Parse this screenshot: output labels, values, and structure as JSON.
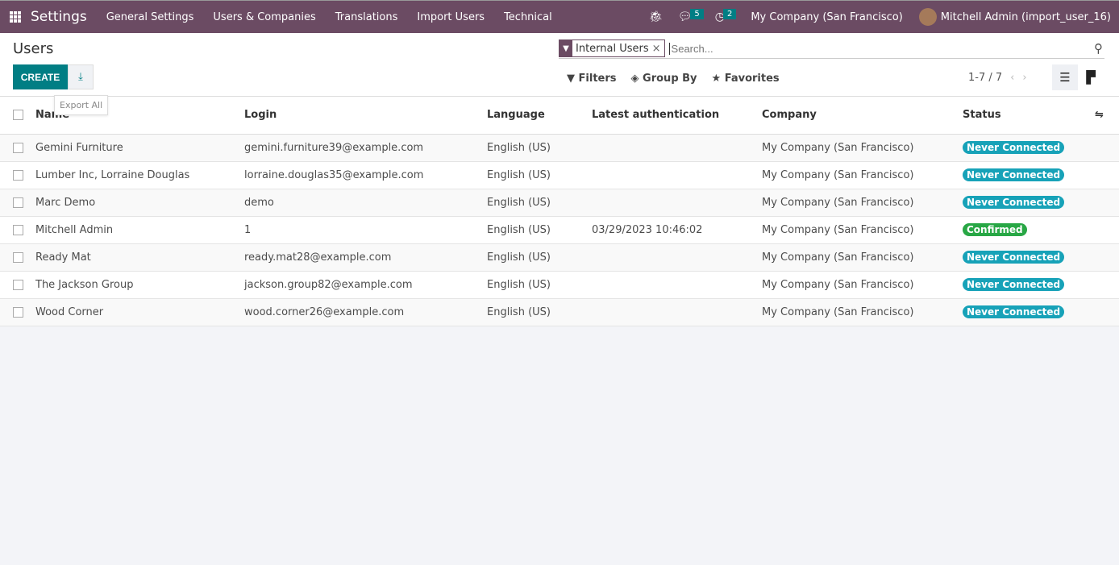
{
  "nav": {
    "brand": "Settings",
    "menus": [
      "General Settings",
      "Users & Companies",
      "Translations",
      "Import Users",
      "Technical"
    ],
    "messages_count": "5",
    "activities_count": "2",
    "company": "My Company (San Francisco)",
    "user": "Mitchell Admin (import_user_16)"
  },
  "page": {
    "title": "Users",
    "create_label": "CREATE",
    "export_tooltip": "Export All"
  },
  "search": {
    "facet": "Internal Users",
    "placeholder": "Search...",
    "filters": "Filters",
    "group_by": "Group By",
    "favorites": "Favorites",
    "pager": "1-7 / 7"
  },
  "table": {
    "headers": [
      "Name",
      "Login",
      "Language",
      "Latest authentication",
      "Company",
      "Status"
    ],
    "rows": [
      {
        "name": "Gemini Furniture",
        "login": "gemini.furniture39@example.com",
        "lang": "English (US)",
        "auth": "",
        "company": "My Company (San Francisco)",
        "status": "Never Connected"
      },
      {
        "name": "Lumber Inc, Lorraine Douglas",
        "login": "lorraine.douglas35@example.com",
        "lang": "English (US)",
        "auth": "",
        "company": "My Company (San Francisco)",
        "status": "Never Connected"
      },
      {
        "name": "Marc Demo",
        "login": "demo",
        "lang": "English (US)",
        "auth": "",
        "company": "My Company (San Francisco)",
        "status": "Never Connected"
      },
      {
        "name": "Mitchell Admin",
        "login": "1",
        "lang": "English (US)",
        "auth": "03/29/2023 10:46:02",
        "company": "My Company (San Francisco)",
        "status": "Confirmed"
      },
      {
        "name": "Ready Mat",
        "login": "ready.mat28@example.com",
        "lang": "English (US)",
        "auth": "",
        "company": "My Company (San Francisco)",
        "status": "Never Connected"
      },
      {
        "name": "The Jackson Group",
        "login": "jackson.group82@example.com",
        "lang": "English (US)",
        "auth": "",
        "company": "My Company (San Francisco)",
        "status": "Never Connected"
      },
      {
        "name": "Wood Corner",
        "login": "wood.corner26@example.com",
        "lang": "English (US)",
        "auth": "",
        "company": "My Company (San Francisco)",
        "status": "Never Connected"
      }
    ]
  },
  "colors": {
    "brand": "#6b4b63",
    "primary": "#017e84",
    "never": "#17a2b8",
    "confirmed": "#28a745"
  }
}
